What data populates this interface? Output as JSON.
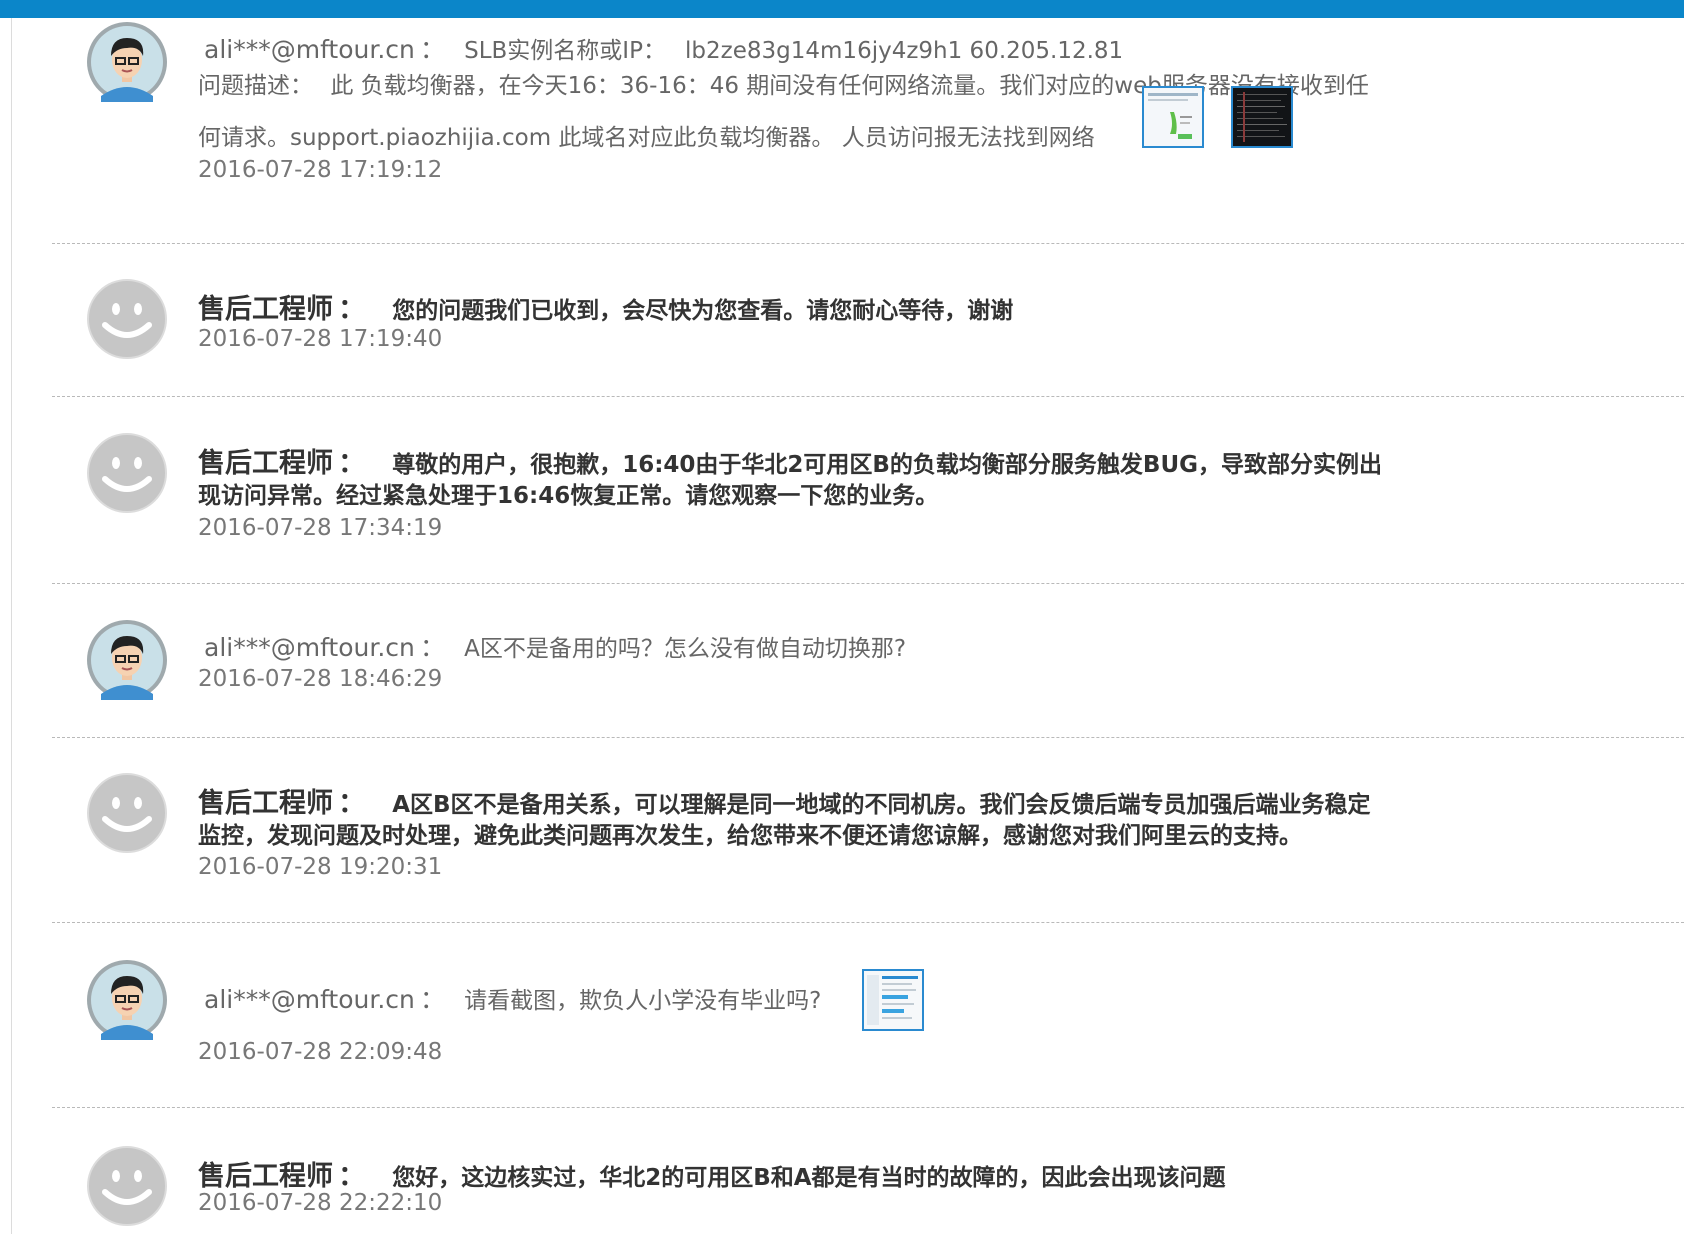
{
  "messages": [
    {
      "role": "user",
      "name": "ali***@mftour.cn",
      "colon": "：",
      "slb_label": "SLB实例名称或IP：",
      "slb_value": "lb2ze83g14m16jy4z9h1 60.205.12.81",
      "desc_label": "问题描述：",
      "desc_line1": "此 负载均衡器，在今天16：36-16：46 期间没有任何网络流量。我们对应的web服务器没有接收到任",
      "desc_line2": "何请求。support.piaozhijia.com  此域名对应此负载均衡器。 人员访问报无法找到网络",
      "time": "2016-07-28 17:19:12"
    },
    {
      "role": "engineer",
      "name": "售后工程师",
      "colon": "：",
      "text": "您的问题我们已收到，会尽快为您查看。请您耐心等待，谢谢",
      "time": "2016-07-28 17:19:40"
    },
    {
      "role": "engineer",
      "name": "售后工程师",
      "colon": "：",
      "text_line1": "尊敬的用户，很抱歉，16:40由于华北2可用区B的负载均衡部分服务触发BUG，导致部分实例出",
      "text_line2": "现访问异常。经过紧急处理于16:46恢复正常。请您观察一下您的业务。",
      "time": "2016-07-28 17:34:19"
    },
    {
      "role": "user",
      "name": "ali***@mftour.cn",
      "colon": "：",
      "text": "A区不是备用的吗？怎么没有做自动切换那?",
      "time": "2016-07-28 18:46:29"
    },
    {
      "role": "engineer",
      "name": "售后工程师",
      "colon": "：",
      "text_line1": "A区B区不是备用关系，可以理解是同一地域的不同机房。我们会反馈后端专员加强后端业务稳定",
      "text_line2": "监控，发现问题及时处理，避免此类问题再次发生，给您带来不便还请您谅解，感谢您对我们阿里云的支持。",
      "time": "2016-07-28 19:20:31"
    },
    {
      "role": "user",
      "name": "ali***@mftour.cn",
      "colon": "：",
      "text": "请看截图，欺负人小学没有毕业吗?",
      "time": "2016-07-28 22:09:48"
    },
    {
      "role": "engineer",
      "name": "售后工程师",
      "colon": "：",
      "text": "您好，这边核实过，华北2的可用区B和A都是有当时的故障的，因此会出现该问题",
      "time": "2016-07-28 22:22:10"
    }
  ],
  "colors": {
    "top_bar": "#0b86c9",
    "thumb_border": "#2a8ad0",
    "engineer_avatar": "#cccccc"
  },
  "icons": {
    "user_avatar": "user-avatar-icon",
    "engineer_avatar": "smiley-avatar-icon",
    "attachment": "screenshot-thumbnail"
  }
}
